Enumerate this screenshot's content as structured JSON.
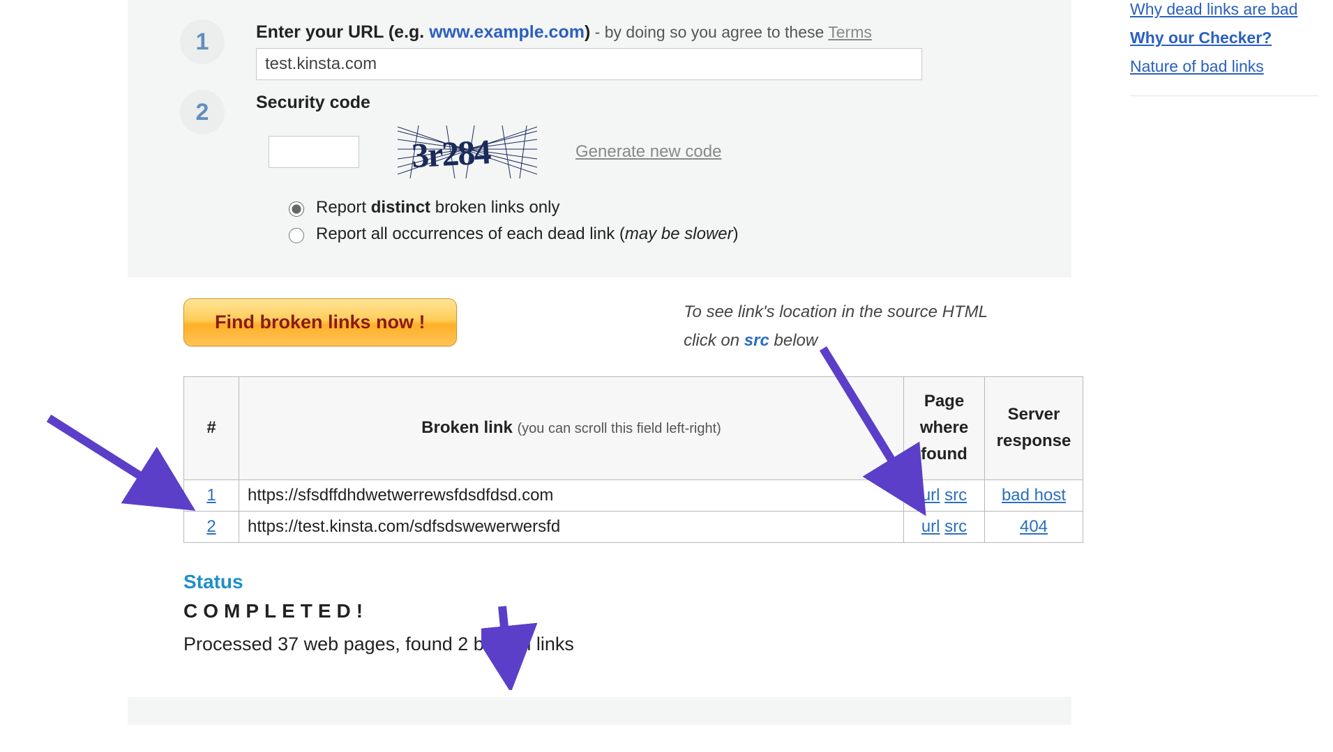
{
  "step1": {
    "label_prefix": "Enter your URL ",
    "label_example_open": "(e.g. ",
    "label_example_url": "www.example.com",
    "label_example_close": ")",
    "agree_text": " - by doing so you agree to these ",
    "terms": "Terms",
    "url_value": "test.kinsta.com"
  },
  "step2": {
    "label": "Security code",
    "captcha_text": "3r284",
    "generate": "Generate new code",
    "radio1_pre": "Report ",
    "radio1_bold": "distinct",
    "radio1_post": " broken links only",
    "radio2_pre": "Report all occurrences of each dead link (",
    "radio2_ital": "may be slower",
    "radio2_post": ")"
  },
  "find_button": "Find broken links now !",
  "hint_line1_pre": "To see link's location in the source HTML",
  "hint_line2_pre": "click on ",
  "hint_line2_src": "src",
  "hint_line2_post": " below",
  "table": {
    "headers": {
      "num": "#",
      "broken": "Broken link",
      "broken_sub": "(you can scroll this field left-right)",
      "pwf": "Page where found",
      "resp": "Server response"
    },
    "rows": [
      {
        "n": "1",
        "link": "https://sfsdffdhdwetwerrewsfdsdfdsd.com",
        "url": "url",
        "src": "src",
        "resp": "bad host"
      },
      {
        "n": "2",
        "link": "https://test.kinsta.com/sdfsdswewerwersfd",
        "url": "url",
        "src": "src",
        "resp": "404"
      }
    ]
  },
  "status": {
    "label": "Status",
    "completed": "COMPLETED!",
    "summary": "Processed 37 web pages, found 2 broken links"
  },
  "sidebar": {
    "links": [
      {
        "label": "Why dead links are bad"
      },
      {
        "label": "Why our Checker?"
      },
      {
        "label": "Nature of bad links"
      }
    ]
  }
}
